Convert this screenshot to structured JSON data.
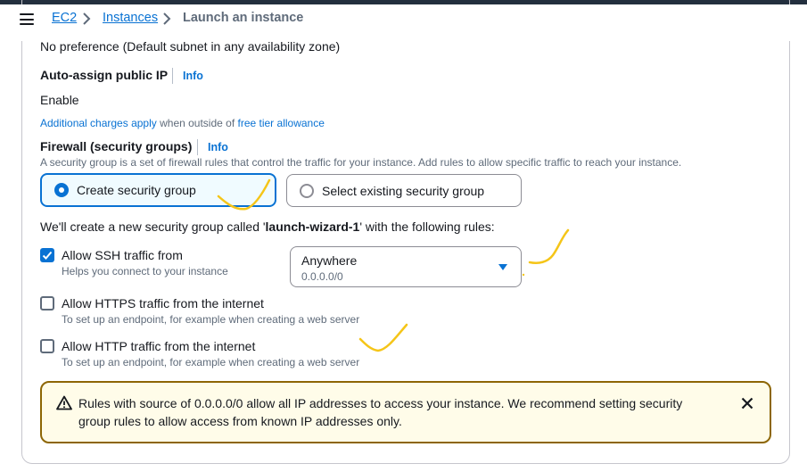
{
  "breadcrumb": {
    "items": [
      {
        "label": "EC2"
      },
      {
        "label": "Instances"
      }
    ],
    "current": "Launch an instance"
  },
  "subnet": {
    "value": "No preference (Default subnet in any availability zone)"
  },
  "auto_assign_ip": {
    "label": "Auto-assign public IP",
    "info": "Info",
    "value": "Enable",
    "note_link": "Additional charges apply",
    "note_text": " when outside of ",
    "note_link2": "free tier allowance"
  },
  "firewall": {
    "label": "Firewall (security groups)",
    "info": "Info",
    "description": "A security group is a set of firewall rules that control the traffic for your instance. Add rules to allow specific traffic to reach your instance.",
    "options": [
      {
        "label": "Create security group",
        "selected": true
      },
      {
        "label": "Select existing security group",
        "selected": false
      }
    ],
    "create_note_pre": "We'll create a new security group called '",
    "create_note_name": "launch-wizard-1",
    "create_note_post": "' with the following rules:"
  },
  "rules": [
    {
      "label": "Allow SSH traffic from",
      "hint": "Helps you connect to your instance",
      "checked": true
    },
    {
      "label": "Allow HTTPS traffic from the internet",
      "hint": "To set up an endpoint, for example when creating a web server",
      "checked": false
    },
    {
      "label": "Allow HTTP traffic from the internet",
      "hint": "To set up an endpoint, for example when creating a web server",
      "checked": false
    }
  ],
  "ssh_source": {
    "selected": "Anywhere",
    "sub": "0.0.0.0/0"
  },
  "alert": {
    "text_line1": "Rules with source of 0.0.0.0/0 allow all IP addresses to access your instance. We recommend setting security",
    "text_line2": "group rules to allow access from known IP addresses only."
  },
  "colors": {
    "link": "#0972d3",
    "warning_border": "#8d6605",
    "warning_bg": "#fffce9",
    "annotation": "#f5c518"
  }
}
